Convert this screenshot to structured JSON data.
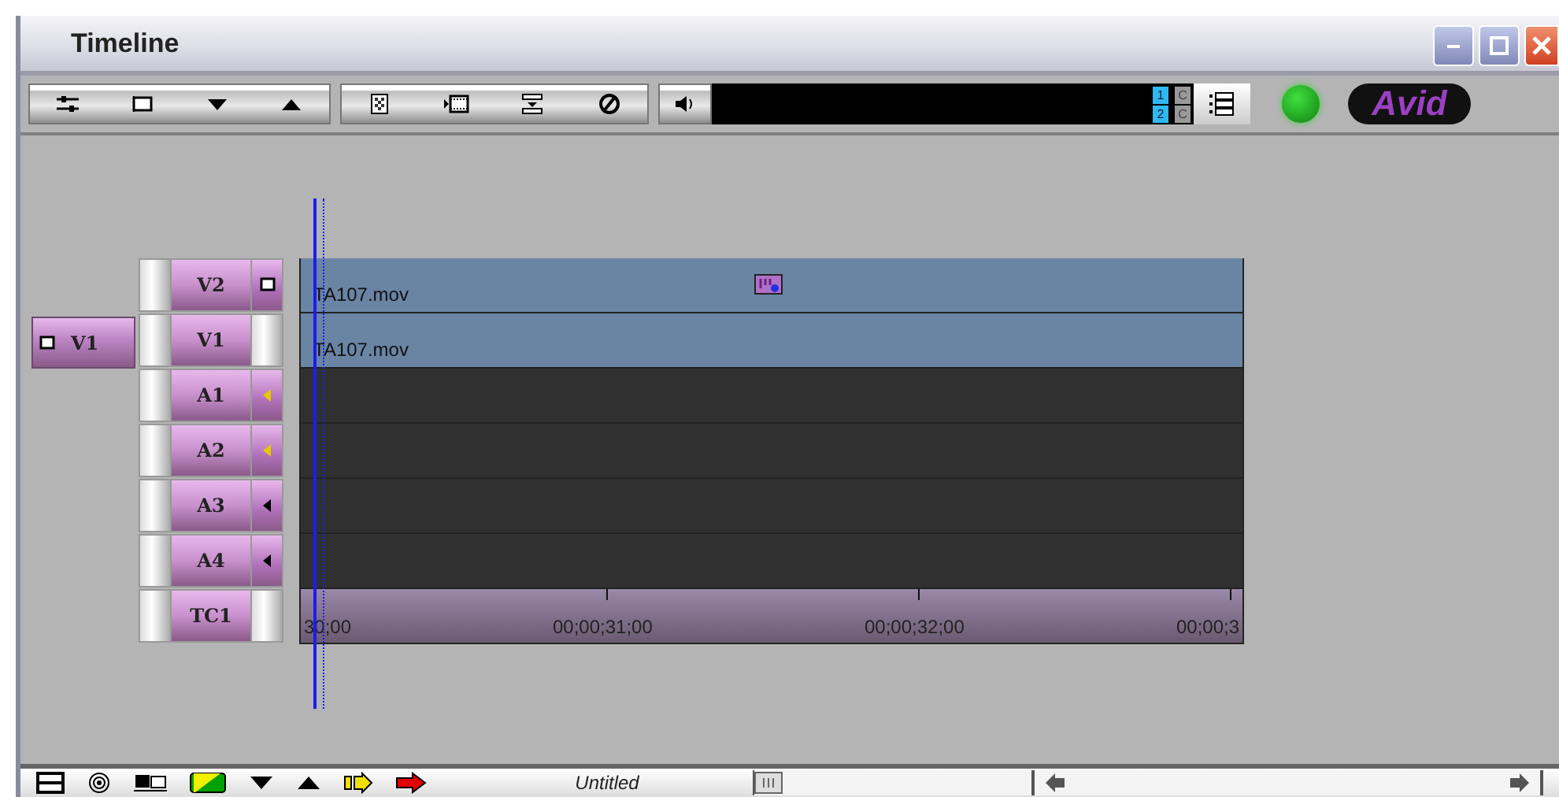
{
  "window": {
    "title": "Timeline"
  },
  "toolbar": {
    "track_numbers": [
      "1",
      "2"
    ],
    "track_flags": [
      "C",
      "C"
    ],
    "logo": "Avid",
    "led_on": true
  },
  "source_tracks": [
    {
      "label": "V1",
      "kind": "video"
    }
  ],
  "tracks": [
    {
      "label": "V2",
      "kind": "video",
      "monitor": true,
      "clip": "TA107.mov",
      "effect": true
    },
    {
      "label": "V1",
      "kind": "video",
      "monitor": false,
      "clip": "TA107.mov",
      "effect": false
    },
    {
      "label": "A1",
      "kind": "audio",
      "monitor": true
    },
    {
      "label": "A2",
      "kind": "audio",
      "monitor": true
    },
    {
      "label": "A3",
      "kind": "audio",
      "monitor": false
    },
    {
      "label": "A4",
      "kind": "audio",
      "monitor": false
    },
    {
      "label": "TC1",
      "kind": "timecode",
      "ruler": [
        "30;00",
        "00;00;31;00",
        "00;00;32;00",
        "00;00;3"
      ]
    }
  ],
  "status_bar": {
    "sequence": "Untitled",
    "scale_slider": {
      "level": 0
    }
  }
}
